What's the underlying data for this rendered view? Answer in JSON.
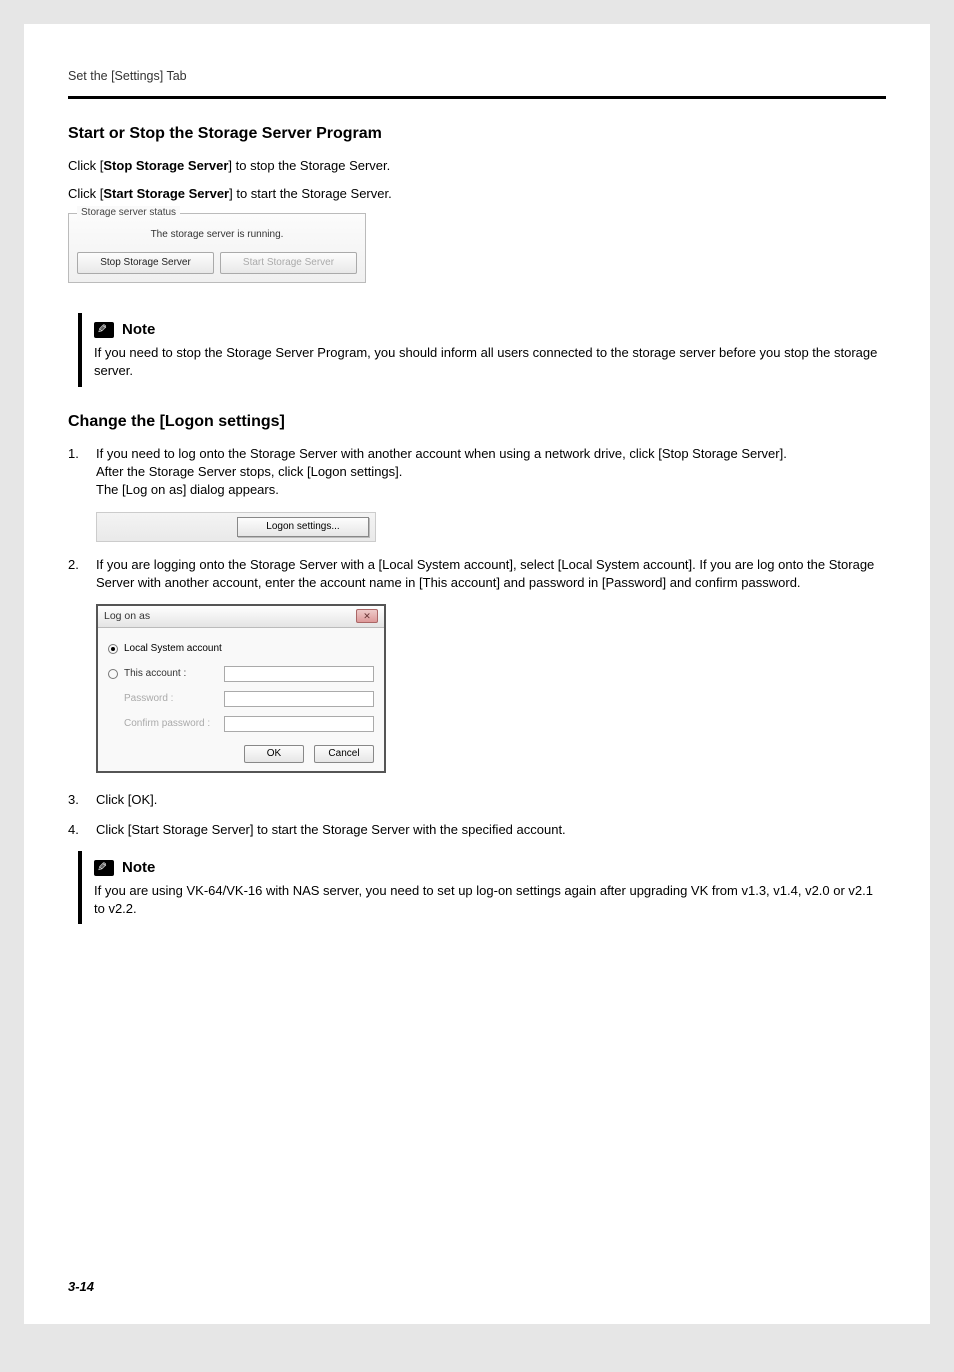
{
  "header": {
    "breadcrumb": "Set the [Settings] Tab"
  },
  "section1": {
    "heading": "Start or Stop the Storage Server Program",
    "p1a": "Click [",
    "p1b": "Stop Storage Server",
    "p1c": "] to stop the Storage Server.",
    "p2a": "Click [",
    "p2b": "Start Storage Server",
    "p2c": "] to start the Storage Server."
  },
  "ssbox": {
    "legend": "Storage server status",
    "status": "The storage server is running.",
    "stop": "Stop Storage Server",
    "start": "Start Storage Server"
  },
  "note1": {
    "title": "Note",
    "body": "If you need to stop the Storage Server Program, you should inform all users connected to the storage server before you stop the storage server."
  },
  "section2": {
    "heading": "Change the [Logon settings]",
    "step1": "If you need to log onto the Storage Server with another account when using a network drive, click [Stop Storage Server].\nAfter the Storage Server stops, click [Logon settings].\nThe [Log on as] dialog appears.",
    "logon_btn": "Logon settings...",
    "step2": "If you are logging onto the Storage Server with a [Local System account], select [Local System account]. If you are log onto the Storage Server with another account, enter the account name in [This account] and password in [Password] and confirm password.",
    "step3": "Click [OK].",
    "step4": "Click [Start Storage Server] to start the Storage Server with the specified account."
  },
  "dialog": {
    "title": "Log on as",
    "opt_local": "Local System account",
    "opt_this": "This account :",
    "lbl_pass": "Password :",
    "lbl_conf": "Confirm password :",
    "ok": "OK",
    "cancel": "Cancel"
  },
  "note2": {
    "title": "Note",
    "body": "If you are using VK-64/VK-16 with NAS server, you need to set up log-on settings again after upgrading VK from v1.3, v1.4, v2.0 or v2.1 to v2.2."
  },
  "pagenum": "3-14"
}
